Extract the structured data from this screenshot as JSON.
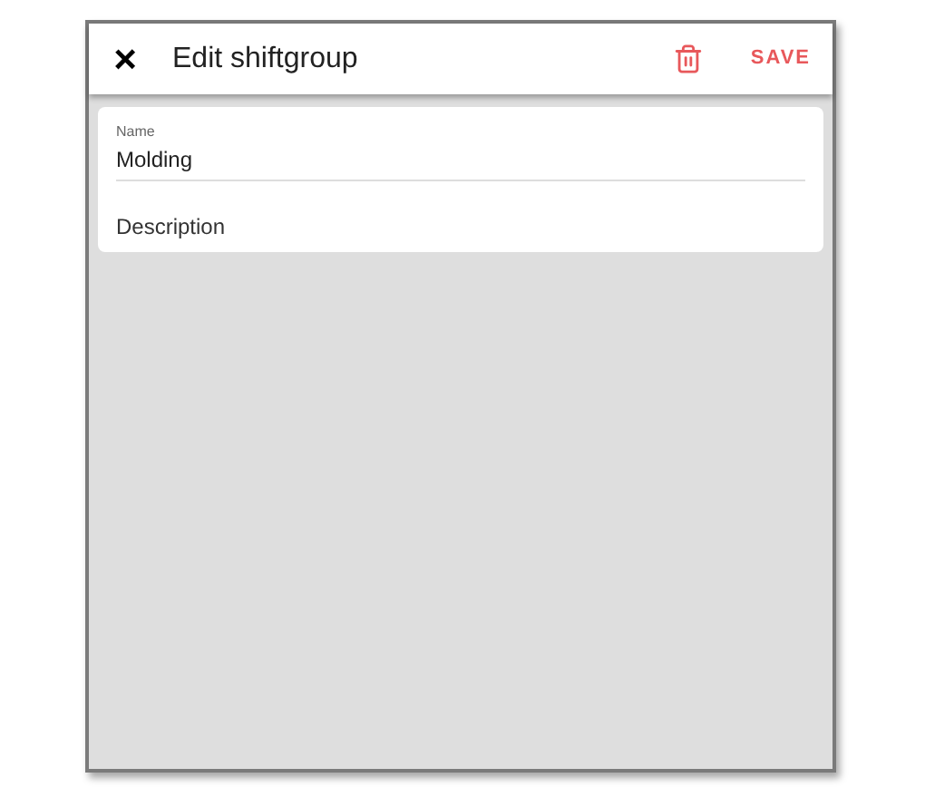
{
  "header": {
    "close": "×",
    "title": "Edit shiftgroup",
    "save": "SAVE"
  },
  "fields": [
    {
      "label": "Name",
      "value": "Molding"
    },
    {
      "placeholder": "Description"
    }
  ]
}
